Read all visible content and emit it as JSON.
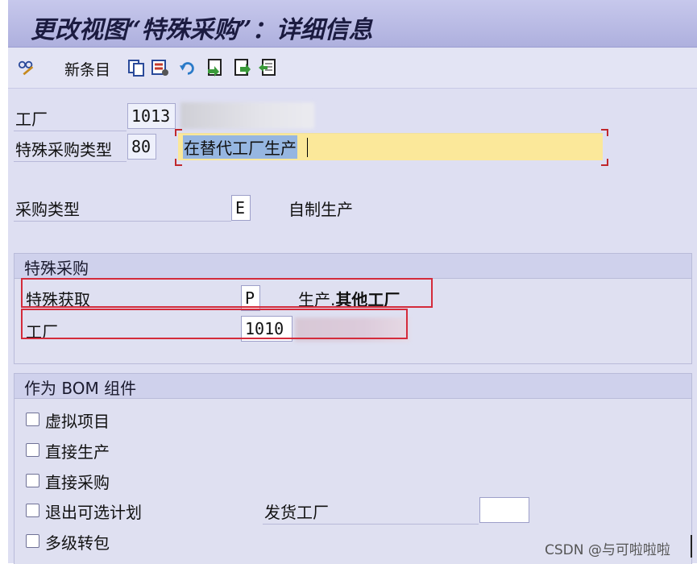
{
  "window": {
    "title": "更改视图“特殊采购”：详细信息"
  },
  "toolbar": {
    "new_entries_label": "新条目",
    "icons": [
      "glasses-pencil-icon",
      "copy-icon",
      "delete-icon",
      "undo-icon",
      "select-all-icon",
      "deselect-icon",
      "previous-entry-icon"
    ]
  },
  "fields": {
    "plant": {
      "label": "工厂",
      "value": "1013"
    },
    "special_proc_type": {
      "label": "特殊采购类型",
      "value": "80",
      "description": "在替代工厂生产"
    },
    "procurement_type": {
      "label": "采购类型",
      "value": "E",
      "description": "自制生产"
    }
  },
  "special_procurement_group": {
    "title": "特殊采购",
    "special_procurement": {
      "label": "特殊获取",
      "value": "P",
      "desc_prefix": "生产.",
      "desc_bold": "其他工厂"
    },
    "plant": {
      "label": "工厂",
      "value": "1010"
    }
  },
  "bom_group": {
    "title": "作为 BOM 组件",
    "checkboxes": [
      {
        "label": "虚拟项目",
        "checked": false
      },
      {
        "label": "直接生产",
        "checked": false
      },
      {
        "label": "直接采购",
        "checked": false
      },
      {
        "label": "退出可选计划",
        "checked": false
      },
      {
        "label": "多级转包",
        "checked": false
      }
    ],
    "issuing_plant": {
      "label": "发货工厂",
      "value": ""
    }
  },
  "watermark": "CSDN @与可啦啦啦",
  "colors": {
    "accent_red": "#d42b3b",
    "highlight_yellow": "#fbe89a",
    "selection_blue": "#96b6e1"
  }
}
